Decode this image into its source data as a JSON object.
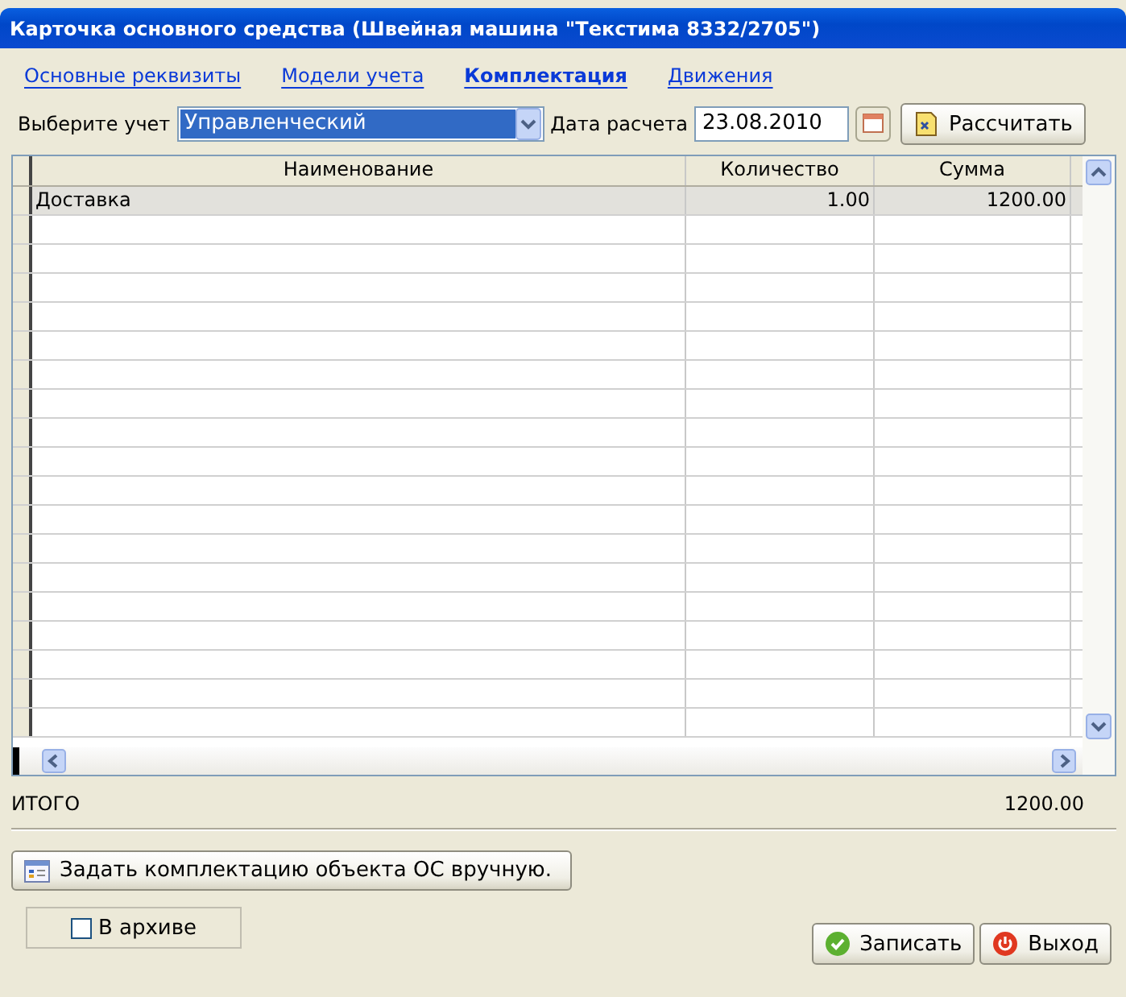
{
  "window": {
    "title": "Карточка основного средства (Швейная машина \"Текстима 8332/2705\")"
  },
  "tabs": [
    {
      "label": "Основные реквизиты",
      "selected": false
    },
    {
      "label": "Модели учета",
      "selected": false
    },
    {
      "label": "Комплектация",
      "selected": true
    },
    {
      "label": "Движения",
      "selected": false
    }
  ],
  "filter": {
    "account_label": "Выберите учет",
    "account_value": "Управленческий",
    "date_label": "Дата расчета",
    "date_value": "23.08.2010",
    "calculate_button": "Рассчитать"
  },
  "table": {
    "columns": [
      "Наименование",
      "Количество",
      "Сумма"
    ],
    "rows": [
      {
        "cells": [
          "Доставка",
          "1.00",
          "1200.00"
        ],
        "selected": true
      }
    ]
  },
  "total": {
    "label": "ИТОГО",
    "value": "1200.00"
  },
  "manual_button": "Задать комплектацию объекта ОС вручную.",
  "archive": {
    "label": "В архиве",
    "checked": false
  },
  "buttons": [
    {
      "kind": "save",
      "label": "Записать"
    },
    {
      "kind": "exit",
      "label": "Выход"
    }
  ]
}
